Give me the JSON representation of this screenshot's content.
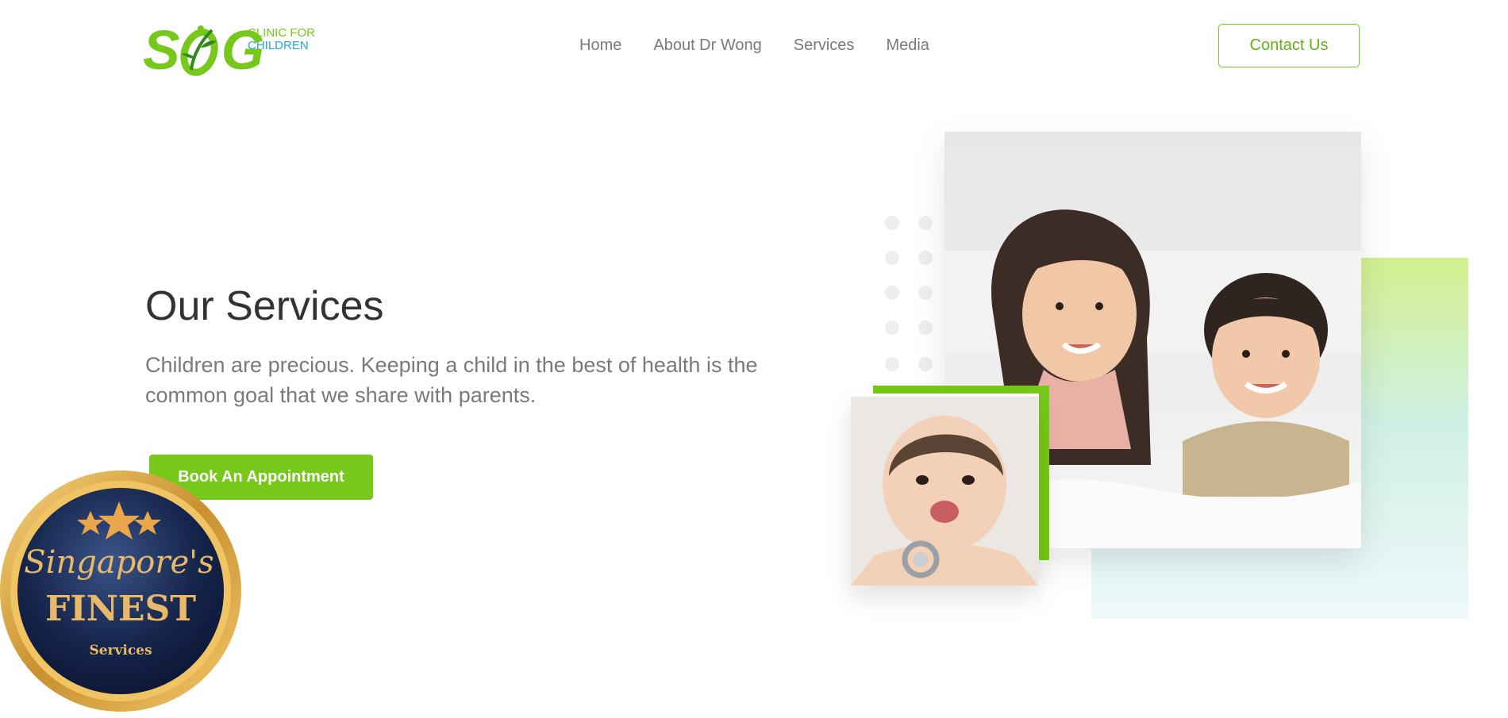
{
  "header": {
    "logo": {
      "mark": "SOG",
      "line1": "CLINIC FOR",
      "line2": "CHILDREN"
    },
    "nav": [
      "Home",
      "About Dr Wong",
      "Services",
      "Media"
    ],
    "contact_label": "Contact Us"
  },
  "hero": {
    "title": "Our Services",
    "description": "Children are precious. Keeping a child in the best of health is the common goal that we share with parents.",
    "cta_label": "Book An Appointment"
  },
  "badge": {
    "script": "Singapore's",
    "main": "FINEST",
    "sub": "Services"
  },
  "colors": {
    "brand_green": "#76c81a",
    "brand_blue": "#2aa6d8",
    "text_dark": "#333333",
    "text_muted": "#7a7a7a"
  }
}
